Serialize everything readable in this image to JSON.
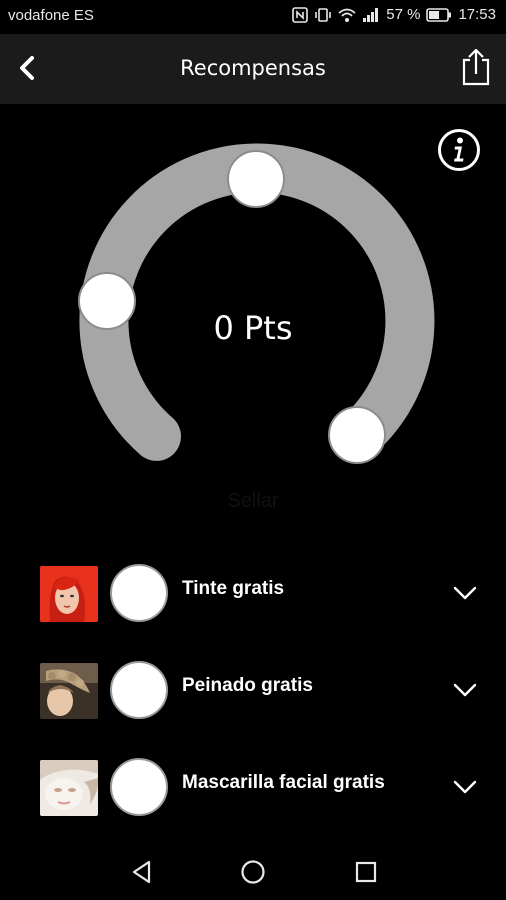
{
  "status_bar": {
    "carrier": "vodafone ES",
    "battery": "57 %",
    "time": "17:53"
  },
  "header": {
    "title": "Recompensas",
    "back_icon": "chevron-left-icon",
    "share_icon": "share-icon"
  },
  "info_icon": "info-icon",
  "gauge": {
    "points": "0 Pts",
    "stamp_label": "Sellar",
    "track_color": "#a6a6a6"
  },
  "rewards": [
    {
      "label": "Tinte gratis",
      "thumb": "red-hair-photo"
    },
    {
      "label": "Peinado gratis",
      "thumb": "braided-hair-photo"
    },
    {
      "label": "Mascarilla facial gratis",
      "thumb": "facial-mask-photo"
    }
  ],
  "nav": {
    "back": "nav-back-icon",
    "home": "nav-home-icon",
    "recents": "nav-recents-icon"
  }
}
